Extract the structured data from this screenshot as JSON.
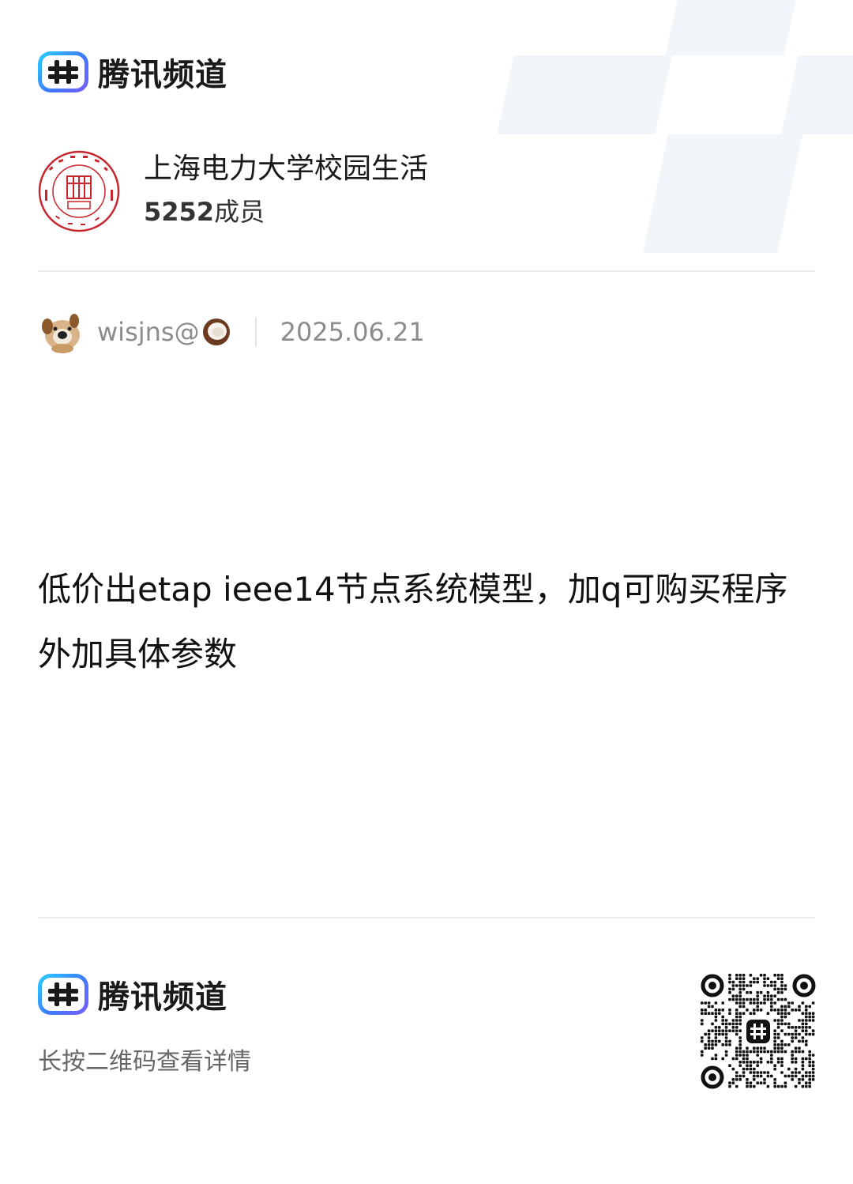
{
  "header": {
    "brand_name": "腾讯频道"
  },
  "channel": {
    "name": "上海电力大学校园生活",
    "member_count": "5252",
    "member_suffix": "成员"
  },
  "post": {
    "author": "wisjns@",
    "author_emoji": "coconut-icon",
    "date": "2025.06.21",
    "content": "低价出etap ieee14节点系统模型，加q可购买程序外加具体参数"
  },
  "footer": {
    "brand_name": "腾讯频道",
    "qr_hint": "长按二维码查看详情"
  },
  "colors": {
    "accent_gradient_start": "#2ad0ff",
    "accent_gradient_end": "#7b5cff",
    "seal_red": "#c8252c"
  }
}
